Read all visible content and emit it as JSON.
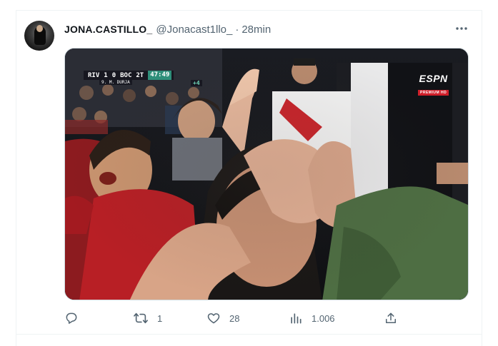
{
  "tweet": {
    "display_name": "JONA.CASTILLO_",
    "handle": "@Jonacast1llo_",
    "separator": "·",
    "time": "28min"
  },
  "media": {
    "scorebug": {
      "home": "RIV",
      "home_score": "1",
      "away_score": "0",
      "away": "BOC",
      "period": "2T",
      "clock": "47:49",
      "scorer": "9. M. DURJA",
      "added_time": "+4"
    },
    "broadcaster": {
      "name": "ESPN",
      "tier": "PREMIUM HD"
    }
  },
  "actions": {
    "reply_count": "",
    "retweet_count": "1",
    "like_count": "28",
    "views_count": "1.006"
  },
  "icons": [
    "avatar",
    "more-icon",
    "reply-icon",
    "retweet-icon",
    "like-icon",
    "views-icon",
    "share-icon"
  ],
  "colors": {
    "text_primary": "#0f1419",
    "text_secondary": "#536471",
    "divider": "#eff3f4",
    "espn_red": "#d01f2a",
    "clock_green": "#2f8f7a"
  }
}
